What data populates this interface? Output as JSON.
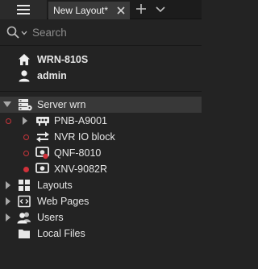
{
  "tabs": {
    "active_label": "New Layout*",
    "items": [
      "New Layout*"
    ]
  },
  "search": {
    "placeholder": "Search",
    "value": ""
  },
  "system": {
    "name": "WRN-810S",
    "user": "admin"
  },
  "tree": {
    "server": {
      "label": "Server wrn",
      "expanded": true
    },
    "devices": [
      {
        "label": "PNB-A9001",
        "status": "offline-ring",
        "icon": "camera-box-icon",
        "has_expander": true
      },
      {
        "label": "NVR IO block",
        "status": "offline-ring",
        "icon": "io-arrows-icon",
        "has_expander": false
      },
      {
        "label": "QNF-8010",
        "status": "offline-ring",
        "icon": "camera-dome-icon",
        "has_expander": false
      },
      {
        "label": "XNV-9082R",
        "status": "recording-filled",
        "icon": "camera-dome-icon",
        "has_expander": false
      }
    ],
    "groups": [
      {
        "label": "Layouts",
        "icon": "layouts-icon"
      },
      {
        "label": "Web Pages",
        "icon": "web-pages-icon"
      },
      {
        "label": "Users",
        "icon": "users-icon"
      },
      {
        "label": "Local Files",
        "icon": "folder-icon"
      }
    ]
  },
  "colors": {
    "background": "#232323",
    "selected_row": "#383838",
    "status_red": "#d0313a",
    "text": "#e6e6e6"
  }
}
